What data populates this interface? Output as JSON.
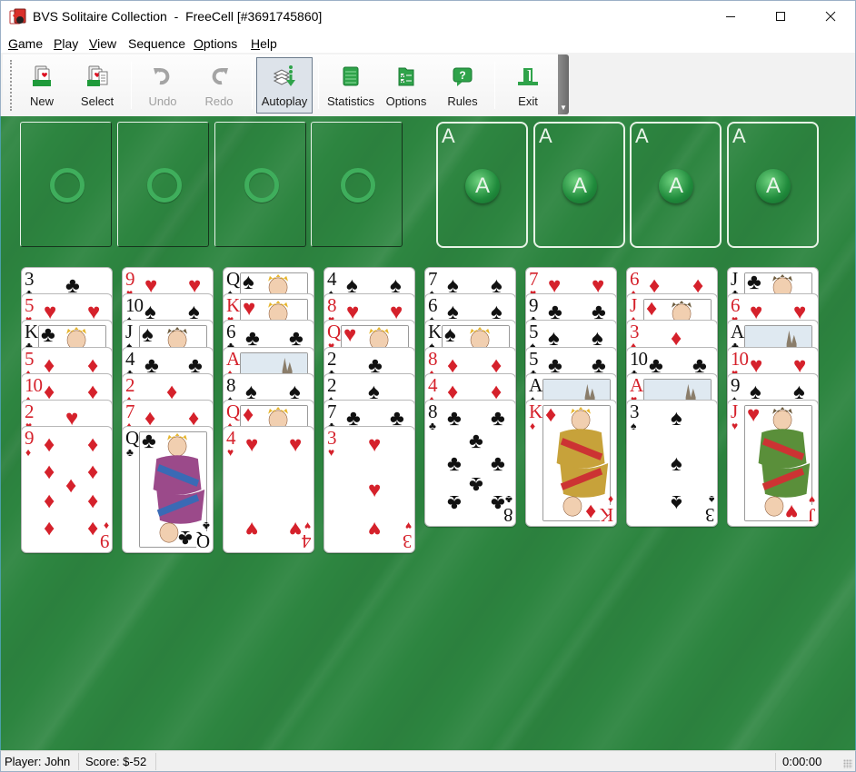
{
  "window": {
    "title": "BVS Solitaire Collection  -  FreeCell [#3691745860]",
    "controls": {
      "minimize": "minimize",
      "maximize": "maximize",
      "close": "close"
    }
  },
  "menu": [
    {
      "label": "Game",
      "mnemonic": "G"
    },
    {
      "label": "Play",
      "mnemonic": "P"
    },
    {
      "label": "View",
      "mnemonic": "V"
    },
    {
      "label": "Sequence",
      "mnemonic": ""
    },
    {
      "label": "Options",
      "mnemonic": "O"
    },
    {
      "label": "Help",
      "mnemonic": "H"
    }
  ],
  "toolbar": {
    "buttons": [
      {
        "id": "new",
        "label": "New",
        "icon": "new-game-icon",
        "enabled": true,
        "active": false
      },
      {
        "id": "select",
        "label": "Select",
        "icon": "select-game-icon",
        "enabled": true,
        "active": false
      },
      {
        "id": "undo",
        "label": "Undo",
        "icon": "undo-icon",
        "enabled": false,
        "active": false
      },
      {
        "id": "redo",
        "label": "Redo",
        "icon": "redo-icon",
        "enabled": false,
        "active": false
      },
      {
        "id": "autoplay",
        "label": "Autoplay",
        "icon": "autoplay-icon",
        "enabled": true,
        "active": true
      },
      {
        "id": "statistics",
        "label": "Statistics",
        "icon": "statistics-icon",
        "enabled": true,
        "active": false
      },
      {
        "id": "options",
        "label": "Options",
        "icon": "options-icon",
        "enabled": true,
        "active": false
      },
      {
        "id": "rules",
        "label": "Rules",
        "icon": "rules-icon",
        "enabled": true,
        "active": false
      },
      {
        "id": "exit",
        "label": "Exit",
        "icon": "exit-icon",
        "enabled": true,
        "active": false
      }
    ]
  },
  "colors": {
    "felt": "#2d8540",
    "red_suit": "#d5212b",
    "black_suit": "#111111",
    "accent_green": "#3fae5c"
  },
  "game": {
    "free_cells": [
      {
        "card": null,
        "placeholder": "ring"
      },
      {
        "card": null,
        "placeholder": "ring"
      },
      {
        "card": null,
        "placeholder": "ring"
      },
      {
        "card": null,
        "placeholder": "ring"
      }
    ],
    "foundations": [
      {
        "card": null,
        "corner_label": "A",
        "badge_label": "A"
      },
      {
        "card": null,
        "corner_label": "A",
        "badge_label": "A"
      },
      {
        "card": null,
        "corner_label": "A",
        "badge_label": "A"
      },
      {
        "card": null,
        "corner_label": "A",
        "badge_label": "A"
      }
    ],
    "tableau": [
      [
        {
          "rank": "3",
          "suit": "clubs"
        },
        {
          "rank": "5",
          "suit": "hearts"
        },
        {
          "rank": "K",
          "suit": "clubs"
        },
        {
          "rank": "5",
          "suit": "diamonds"
        },
        {
          "rank": "10",
          "suit": "diamonds"
        },
        {
          "rank": "2",
          "suit": "hearts"
        },
        {
          "rank": "9",
          "suit": "diamonds"
        }
      ],
      [
        {
          "rank": "9",
          "suit": "hearts"
        },
        {
          "rank": "10",
          "suit": "spades"
        },
        {
          "rank": "J",
          "suit": "spades"
        },
        {
          "rank": "4",
          "suit": "clubs"
        },
        {
          "rank": "2",
          "suit": "diamonds"
        },
        {
          "rank": "7",
          "suit": "diamonds"
        },
        {
          "rank": "Q",
          "suit": "clubs"
        }
      ],
      [
        {
          "rank": "Q",
          "suit": "spades"
        },
        {
          "rank": "K",
          "suit": "hearts"
        },
        {
          "rank": "6",
          "suit": "clubs"
        },
        {
          "rank": "A",
          "suit": "diamonds"
        },
        {
          "rank": "8",
          "suit": "spades"
        },
        {
          "rank": "Q",
          "suit": "diamonds"
        },
        {
          "rank": "4",
          "suit": "hearts"
        }
      ],
      [
        {
          "rank": "4",
          "suit": "spades"
        },
        {
          "rank": "8",
          "suit": "hearts"
        },
        {
          "rank": "Q",
          "suit": "hearts"
        },
        {
          "rank": "2",
          "suit": "clubs"
        },
        {
          "rank": "2",
          "suit": "spades"
        },
        {
          "rank": "7",
          "suit": "clubs"
        },
        {
          "rank": "3",
          "suit": "hearts"
        }
      ],
      [
        {
          "rank": "7",
          "suit": "spades"
        },
        {
          "rank": "6",
          "suit": "spades"
        },
        {
          "rank": "K",
          "suit": "spades"
        },
        {
          "rank": "8",
          "suit": "diamonds"
        },
        {
          "rank": "4",
          "suit": "diamonds"
        },
        {
          "rank": "8",
          "suit": "clubs"
        }
      ],
      [
        {
          "rank": "7",
          "suit": "hearts"
        },
        {
          "rank": "9",
          "suit": "clubs"
        },
        {
          "rank": "5",
          "suit": "spades"
        },
        {
          "rank": "5",
          "suit": "clubs"
        },
        {
          "rank": "A",
          "suit": "spades"
        },
        {
          "rank": "K",
          "suit": "diamonds"
        }
      ],
      [
        {
          "rank": "6",
          "suit": "diamonds"
        },
        {
          "rank": "J",
          "suit": "diamonds"
        },
        {
          "rank": "3",
          "suit": "diamonds"
        },
        {
          "rank": "10",
          "suit": "clubs"
        },
        {
          "rank": "A",
          "suit": "hearts"
        },
        {
          "rank": "3",
          "suit": "spades"
        }
      ],
      [
        {
          "rank": "J",
          "suit": "clubs"
        },
        {
          "rank": "6",
          "suit": "hearts"
        },
        {
          "rank": "A",
          "suit": "clubs"
        },
        {
          "rank": "10",
          "suit": "hearts"
        },
        {
          "rank": "9",
          "suit": "spades"
        },
        {
          "rank": "J",
          "suit": "hearts"
        }
      ]
    ]
  },
  "status": {
    "player": "Player: John",
    "score": "Score: $-52",
    "time": "0:00:00"
  }
}
